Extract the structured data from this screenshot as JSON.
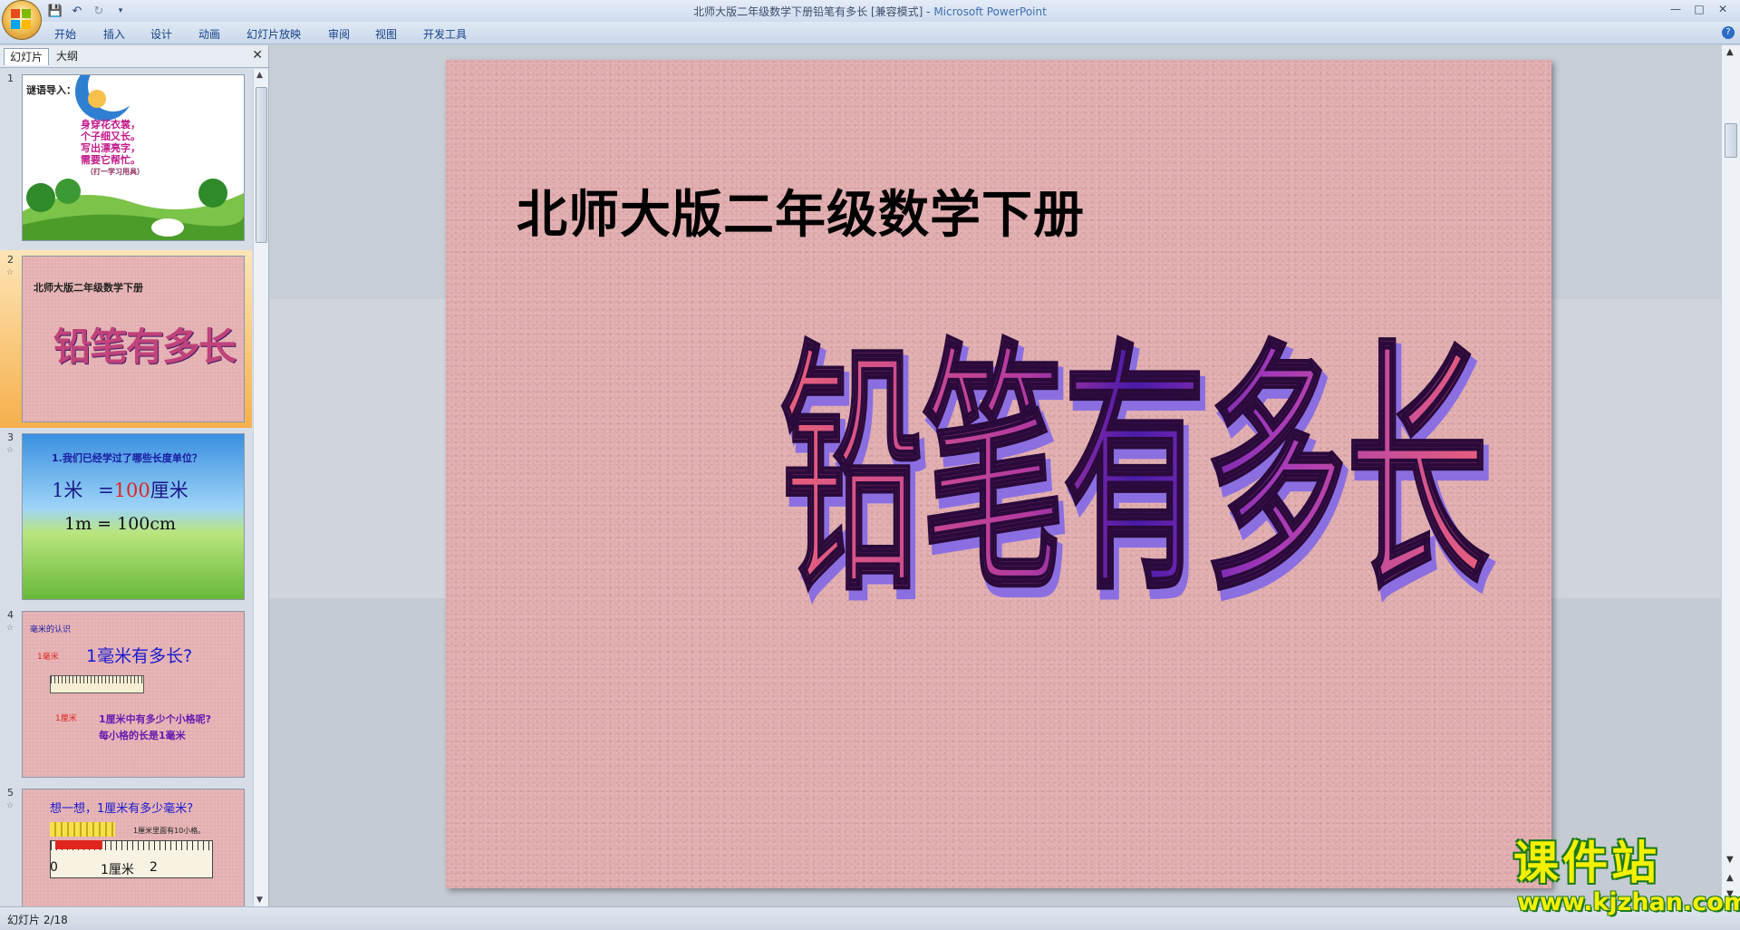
{
  "window": {
    "title": "北师大版二年级数学下册铅笔有多长 [兼容模式] - ",
    "app_name": "Microsoft PowerPoint"
  },
  "ribbon": {
    "tabs": [
      "开始",
      "插入",
      "设计",
      "动画",
      "幻灯片放映",
      "审阅",
      "视图",
      "开发工具"
    ]
  },
  "pane": {
    "tabs": [
      "幻灯片",
      "大纲"
    ],
    "slides": [
      {
        "num": "1",
        "title": "谜语导入：",
        "lines": [
          "身穿花衣裳，",
          "个子细又长。",
          "写出漂亮字，",
          "需要它帮忙。"
        ],
        "hint": "（打一学习用具）"
      },
      {
        "num": "2",
        "subtitle": "北师大版二年级数学下册",
        "title": "铅笔有多长"
      },
      {
        "num": "3",
        "question": "1.我们已经学过了哪些长度单位？",
        "eq1_left": "1米",
        "eq1_eq": "=",
        "eq1_num": "100",
        "eq1_unit": "厘米",
        "eq2": "1m = 100cm"
      },
      {
        "num": "4",
        "tag": "毫米的认识",
        "heading": "1毫米有多长?",
        "label_mm": "1毫米",
        "label_cm": "1厘米",
        "line1": "1厘米中有多少个小格呢?",
        "line2": "每小格的长是1毫米"
      },
      {
        "num": "5",
        "heading": "想一想，1厘米有多少毫米?",
        "note": "1厘米里面有10小格。",
        "ruler_0": "0",
        "ruler_1": "1厘米",
        "ruler_2": "2"
      }
    ]
  },
  "slide": {
    "subtitle": "北师大版二年级数学下册",
    "title": "铅笔有多长"
  },
  "status": {
    "slide_counter": "幻灯片 2/18"
  },
  "watermark": {
    "brand": "课件站",
    "url": "www.kjzhan.com"
  }
}
